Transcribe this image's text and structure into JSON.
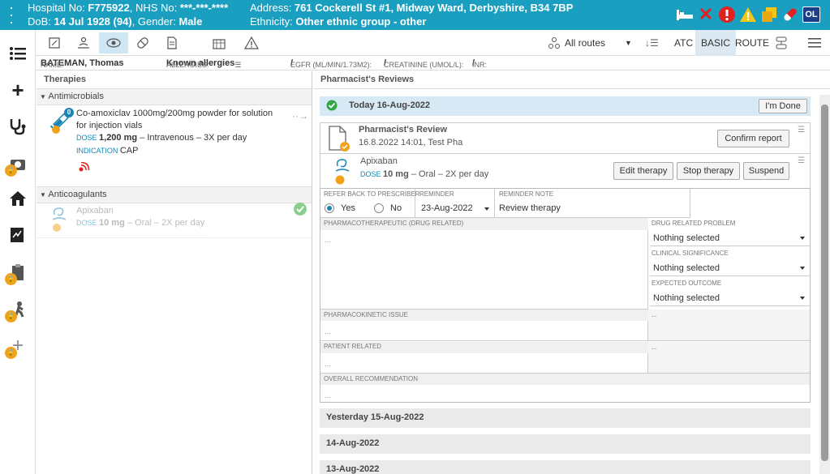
{
  "header": {
    "hospital_label": "Hospital No: ",
    "hospital_no": "F775922",
    "nhs_label": ", NHS No: ",
    "nhs_no": "***-***-****",
    "dob_label": "DoB: ",
    "dob": "14 Jul 1928 (94)",
    "gender_label": ", Gender: ",
    "gender": "Male",
    "address_label": "Address: ",
    "address": "761 Cockerell St #1, Midway Ward, Derbyshire, B34 7BP",
    "ethnicity_label": "Ethnicity: ",
    "ethnicity": "Other ethnic group - other",
    "user_initials": "OL"
  },
  "toolbar": {
    "routes": "All routes",
    "atc": "ATC",
    "basic": "BASIC",
    "route": "ROUTE"
  },
  "info": {
    "name_label": "NAME: ",
    "name": "BATEMAN, Thomas",
    "allergies_label": "ALLERGIES: ",
    "allergies": "Known allergies",
    "egfr_label": "EGFR (ML/MIN/1.73M2): ",
    "egfr": "/",
    "creat_label": "CREATININE (UMOL/L): ",
    "creat": "/",
    "inr_label": "INR: ",
    "inr": "/"
  },
  "left": {
    "title": "Therapies",
    "groups": [
      {
        "name": "Antimicrobials"
      },
      {
        "name": "Anticoagulants"
      }
    ],
    "med1": {
      "line1": "Co-amoxiclav 1000mg/200mg powder for solution",
      "line2": "for injection vials",
      "dose_label": "DOSE ",
      "dose": "1,200 mg",
      "route": " – Intravenous – 3X per day",
      "indication_label": "INDICATION ",
      "indication": "CAP",
      "badge": "0"
    },
    "med2": {
      "name": "Apixaban",
      "dose_label": "DOSE ",
      "dose": "10 mg",
      "route": " – Oral – 2X per day"
    }
  },
  "right": {
    "title": "Pharmacist's Reviews",
    "today": "Today 16-Aug-2022",
    "done": "I'm Done",
    "review_title": "Pharmacist's Review",
    "review_meta": "16.8.2022 14:01, Test Pha",
    "confirm": "Confirm report",
    "drug": "Apixaban",
    "drug_dose_label": "DOSE ",
    "drug_dose": "10 mg",
    "drug_route": " – Oral – 2X per day",
    "edit": "Edit therapy",
    "stop": "Stop therapy",
    "suspend": "Suspend",
    "refer_label": "REFER BACK TO PRESCRIBER",
    "yes": "Yes",
    "no": "No",
    "reminder_label": "REMINDER",
    "reminder": "23-Aug-2022",
    "note_label": "REMINDER NOTE",
    "note": "Review therapy",
    "pharmaco_label": "PHARMACOTHERAPEUTIC (DRUG RELATED)",
    "pharmaco": "...",
    "drp_label": "DRUG RELATED PROBLEM",
    "drp": "Nothing selected",
    "clin_label": "CLINICAL SIGNIFICANCE",
    "clin": "Nothing selected",
    "exp_label": "EXPECTED OUTCOME",
    "exp": "Nothing selected",
    "pk_label": "PHARMACOKINETIC ISSUE",
    "pk": "...",
    "pk_side": "--",
    "pr_label": "PATIENT RELATED",
    "pr": "...",
    "pr_side": "--",
    "overall_label": "OVERALL RECOMMENDATION",
    "overall": "...",
    "days": [
      "Yesterday 15-Aug-2022",
      "14-Aug-2022",
      "13-Aug-2022"
    ]
  }
}
